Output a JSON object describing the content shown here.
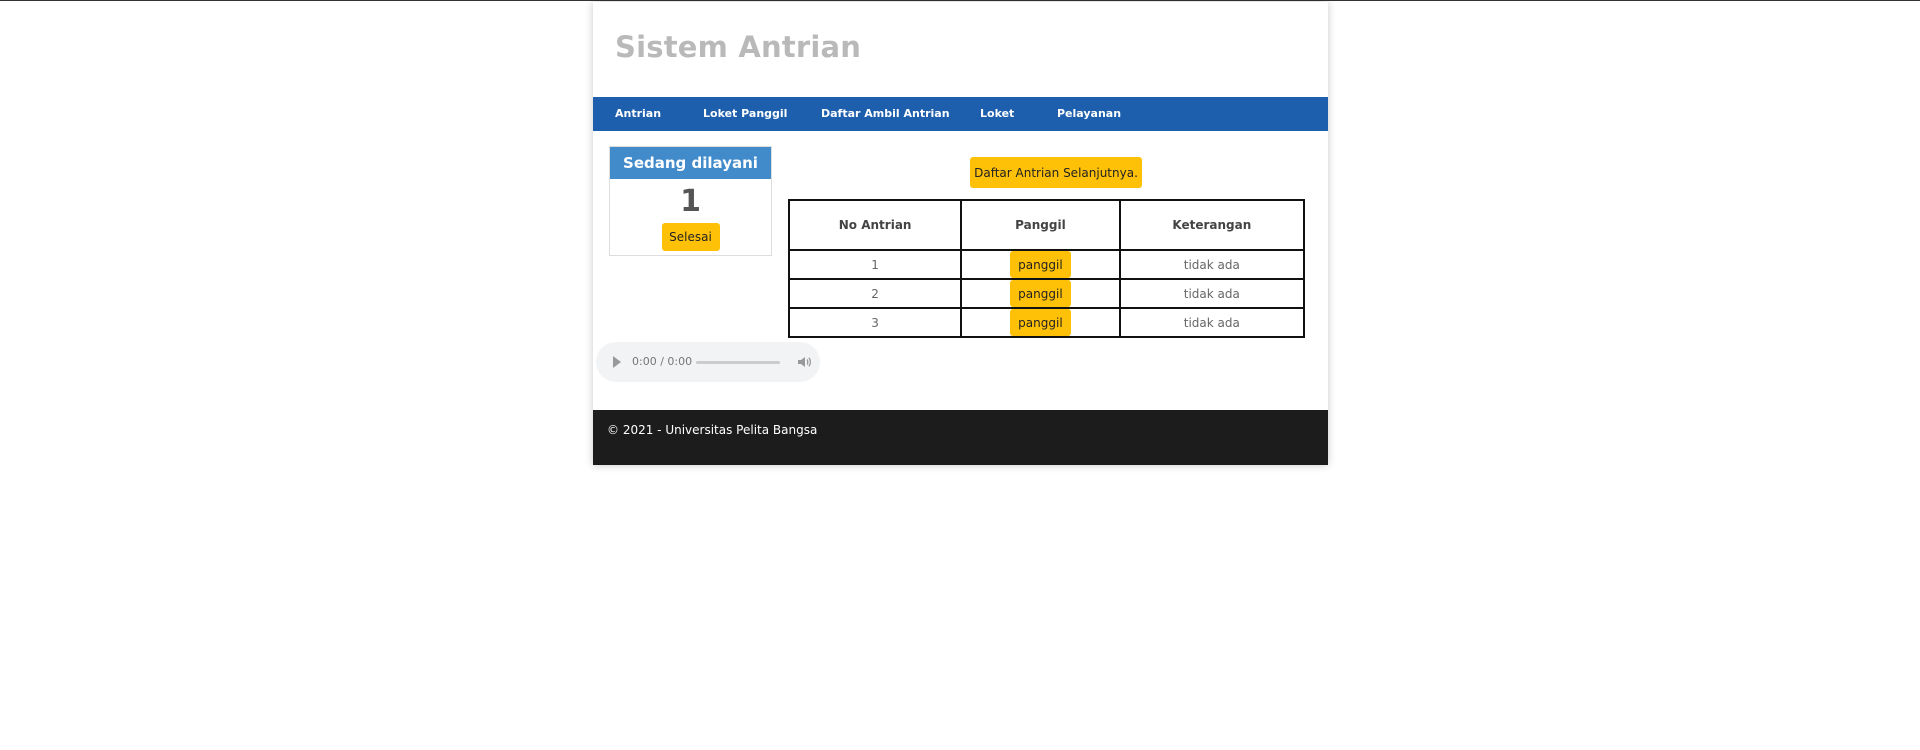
{
  "header": {
    "title": "Sistem Antrian"
  },
  "nav": {
    "items": [
      {
        "label": "Antrian"
      },
      {
        "label": "Loket Panggil"
      },
      {
        "label": "Daftar Ambil Antrian"
      },
      {
        "label": "Loket"
      },
      {
        "label": "Pelayanan"
      }
    ]
  },
  "current": {
    "heading": "Sedang dilayani",
    "number": "1",
    "done_label": "Selesai"
  },
  "queue": {
    "next_label": "Daftar Antrian Selanjutnya.",
    "columns": [
      "No Antrian",
      "Panggil",
      "Keterangan"
    ],
    "rows": [
      {
        "no": "1",
        "action": "panggil",
        "note": "tidak ada"
      },
      {
        "no": "2",
        "action": "panggil",
        "note": "tidak ada"
      },
      {
        "no": "3",
        "action": "panggil",
        "note": "tidak ada"
      }
    ]
  },
  "audio": {
    "time": "0:00 / 0:00",
    "play_icon": "play-icon",
    "volume_icon": "volume-icon"
  },
  "footer": {
    "text": "© 2021 - Universitas Pelita Bangsa"
  },
  "colors": {
    "navbar": "#1d5fad",
    "panel_heading": "#428bca",
    "button": "#ffc107",
    "footer": "#1c1c1c",
    "title": "#b9b9b9"
  }
}
